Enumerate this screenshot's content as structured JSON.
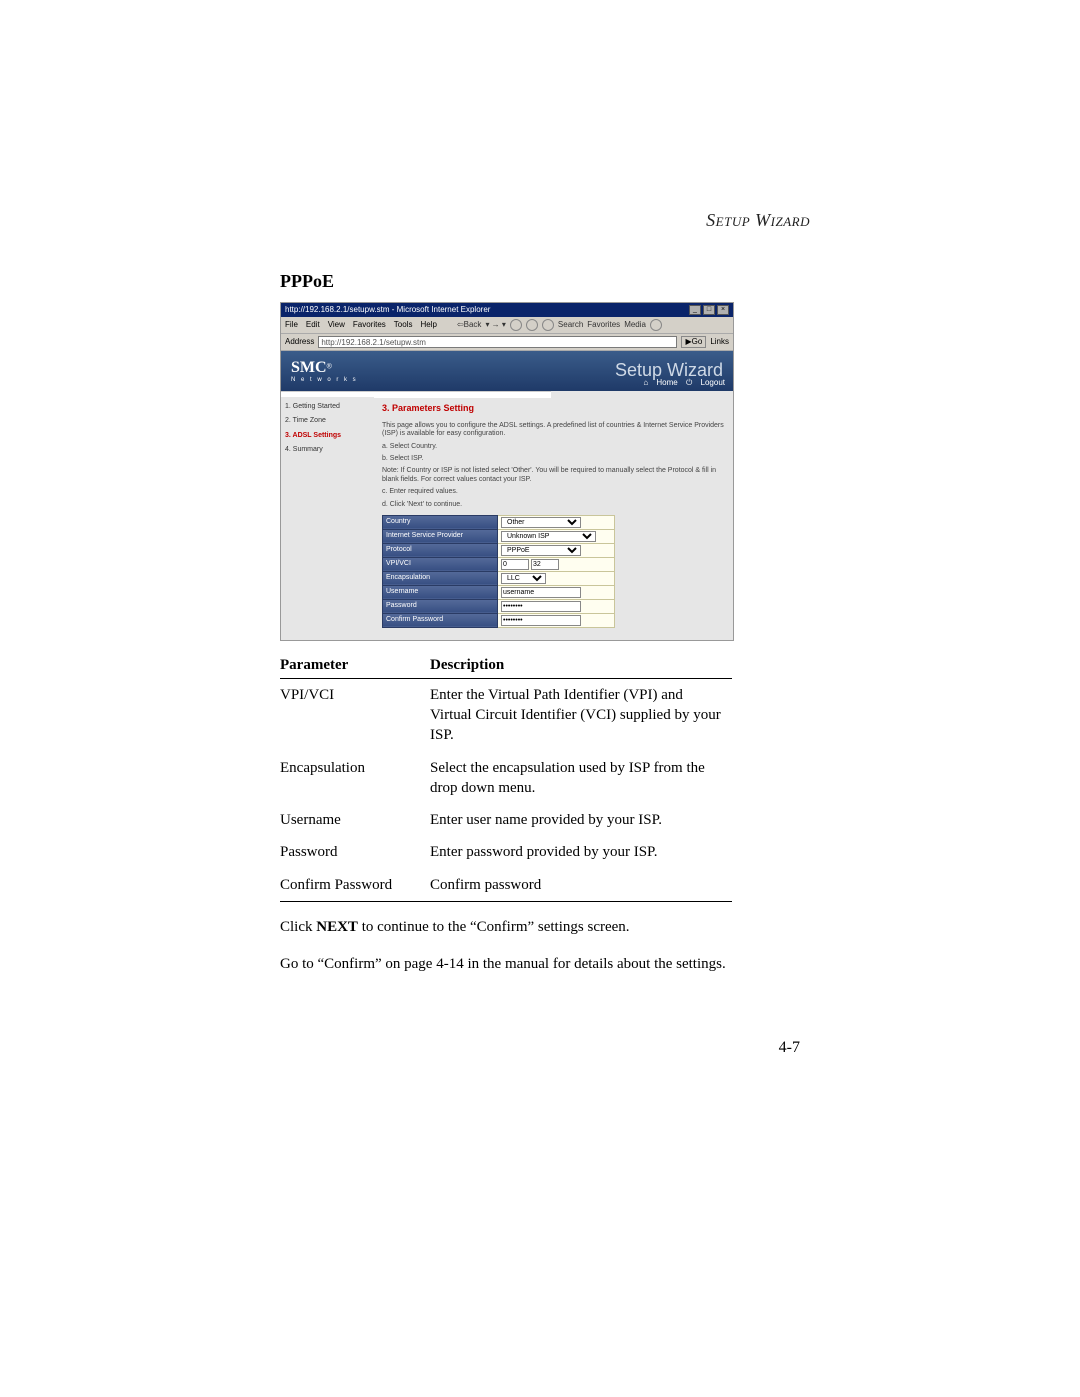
{
  "running_header": "Setup Wizard",
  "section_title": "PPPoE",
  "screenshot": {
    "ie_title": "http://192.168.2.1/setupw.stm - Microsoft Internet Explorer",
    "menu": {
      "file": "File",
      "edit": "Edit",
      "view": "View",
      "favorites": "Favorites",
      "tools": "Tools",
      "help": "Help",
      "back": "Back",
      "search": "Search",
      "fav": "Favorites",
      "media": "Media"
    },
    "address_label": "Address",
    "address": "http://192.168.2.1/setupw.stm",
    "go": "Go",
    "links": "Links",
    "logo_main": "SMC",
    "logo_sub": "N e t w o r k s",
    "big_title": "Setup Wizard",
    "home": "Home",
    "logout": "Logout",
    "sidebar": [
      {
        "label": "1. Getting Started",
        "active": false
      },
      {
        "label": "2. Time Zone",
        "active": false
      },
      {
        "label": "3. ADSL Settings",
        "active": true
      },
      {
        "label": "4. Summary",
        "active": false
      }
    ],
    "heading": "3. Parameters Setting",
    "intro": "This page allows you to configure the ADSL settings. A predefined list of countries & Internet Service Providers (ISP) is available for easy configuration.",
    "step_a": "a. Select Country.",
    "step_b": "b. Select ISP.",
    "note": "Note: If Country or ISP is not listed select 'Other'. You will be required to manually select the Protocol & fill in blank fields. For correct values contact your ISP.",
    "step_c": "c. Enter required values.",
    "step_d": "d. Click 'Next' to continue.",
    "form": {
      "country_label": "Country",
      "country_value": "Other",
      "isp_label": "Internet Service Provider",
      "isp_value": "Unknown ISP",
      "protocol_label": "Protocol",
      "protocol_value": "PPPoE",
      "vpivci_label": "VPI/VCI",
      "vpi": "0",
      "vci": "32",
      "encap_label": "Encapsulation",
      "encap_value": "LLC",
      "user_label": "Username",
      "user_value": "username",
      "pass_label": "Password",
      "pass_value": "••••••••",
      "cpass_label": "Confirm Password",
      "cpass_value": "••••••••"
    }
  },
  "table": {
    "h_param": "Parameter",
    "h_desc": "Description",
    "rows": [
      {
        "p": "VPI/VCI",
        "d": "Enter the Virtual Path Identifier (VPI) and Virtual Circuit Identifier (VCI) supplied by your ISP."
      },
      {
        "p": "Encapsulation",
        "d": "Select the encapsulation used by ISP from the drop down menu."
      },
      {
        "p": "Username",
        "d": "Enter user name provided by your ISP."
      },
      {
        "p": "Password",
        "d": "Enter password provided by your ISP."
      },
      {
        "p": "Confirm Password",
        "d": "Confirm password"
      }
    ]
  },
  "body_line1_pre": "Click ",
  "body_line1_bold": "NEXT",
  "body_line1_post": " to continue to the “Confirm” settings screen.",
  "body_line2": "Go to “Confirm” on page 4-14 in the manual for details about the settings.",
  "page_number": "4-7"
}
